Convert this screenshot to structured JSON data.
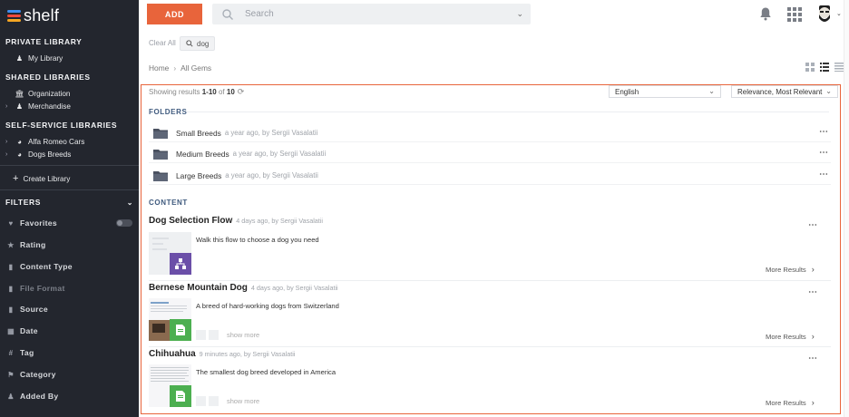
{
  "sidebar": {
    "logo_text": "shelf",
    "logo_colors": [
      "#3d8ef0",
      "#f04b3d",
      "#f5a623"
    ],
    "private_title": "PRIVATE LIBRARY",
    "private_items": [
      {
        "label": "My Library",
        "icon": "users-icon"
      }
    ],
    "shared_title": "SHARED LIBRARIES",
    "shared_items": [
      {
        "label": "Organization",
        "icon": "building-icon"
      },
      {
        "label": "Merchandise",
        "icon": "users-icon"
      }
    ],
    "self_service_title": "SELF-SERVICE LIBRARIES",
    "self_service_items": [
      {
        "label": "Alfa Romeo Cars",
        "icon": "globe-icon"
      },
      {
        "label": "Dogs Breeds",
        "icon": "globe-icon"
      }
    ],
    "create_label": "Create Library",
    "filters_title": "FILTERS",
    "filters": [
      {
        "label": "Favorites",
        "icon": "heart-icon"
      },
      {
        "label": "Rating",
        "icon": "star-icon"
      },
      {
        "label": "Content Type",
        "icon": "file-icon"
      },
      {
        "label": "File Format",
        "icon": "file-icon",
        "disabled": true
      },
      {
        "label": "Source",
        "icon": "file-icon"
      },
      {
        "label": "Date",
        "icon": "calendar-icon"
      },
      {
        "label": "Tag",
        "icon": "hash-icon"
      },
      {
        "label": "Category",
        "icon": "tag-icon"
      },
      {
        "label": "Added By",
        "icon": "user-icon"
      }
    ]
  },
  "topbar": {
    "add_label": "ADD",
    "search_placeholder": "Search",
    "accent_color": "#e8643b"
  },
  "search_chips": {
    "clear_all": "Clear All",
    "chip_label": "dog"
  },
  "breadcrumb": {
    "home": "Home",
    "current": "All Gems"
  },
  "results": {
    "showing_prefix": "Showing results",
    "range": "1-10",
    "of": "of",
    "total": "10",
    "language": "English",
    "sort": "Relevance, Most Relevant"
  },
  "folders": {
    "title": "FOLDERS",
    "items": [
      {
        "name": "Small Breeds",
        "meta": "a year ago, by Sergii Vasalatii"
      },
      {
        "name": "Medium Breeds",
        "meta": "a year ago, by Sergii Vasalatii"
      },
      {
        "name": "Large Breeds",
        "meta": "a year ago, by Sergii Vasalatii"
      }
    ]
  },
  "content": {
    "title": "CONTENT",
    "items": [
      {
        "title": "Dog Selection Flow",
        "meta": "4 days ago, by Sergii Vasalatii",
        "desc": "Walk this flow to choose a dog you need",
        "more_results": "More Results",
        "badge_color": "#6b4fa8",
        "badge_icon": "flow-icon"
      },
      {
        "title": "Bernese Mountain Dog",
        "meta": "4 days ago, by Sergii Vasalatii",
        "desc": "A breed of hard-working dogs from Switzerland",
        "show_more": "show more",
        "more_results": "More Results",
        "badge_color": "#4caf50",
        "badge_icon": "document-icon"
      },
      {
        "title": "Chihuahua",
        "meta": "9 minutes ago, by Sergii Vasalatii",
        "desc": "The smallest dog breed developed in America",
        "show_more": "show more",
        "more_results": "More Results",
        "badge_color": "#4caf50",
        "badge_icon": "document-icon"
      }
    ]
  }
}
